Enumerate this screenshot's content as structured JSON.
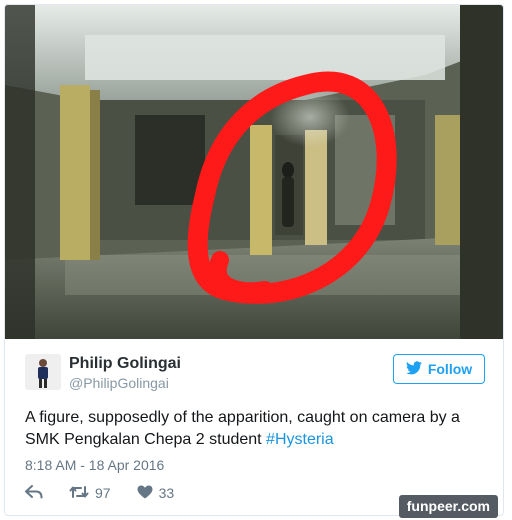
{
  "tweet": {
    "author_name": "Philip Golingai",
    "author_handle": "@PhilipGolingai",
    "follow_label": "Follow",
    "text_prefix": "A figure, supposedly of the apparition, caught on camera by a SMK Pengkalan Chepa 2 student ",
    "hashtag": "#Hysteria",
    "timestamp": "8:18 AM - 18 Apr 2016",
    "retweet_count": "97",
    "like_count": "33"
  },
  "watermark": "funpeer.com",
  "colors": {
    "twitter_blue": "#1da1f2",
    "circle_red": "#ff1a1a"
  },
  "icons": {
    "reply": "reply-icon",
    "retweet": "retweet-icon",
    "like": "heart-icon",
    "bird": "twitter-bird-icon"
  }
}
